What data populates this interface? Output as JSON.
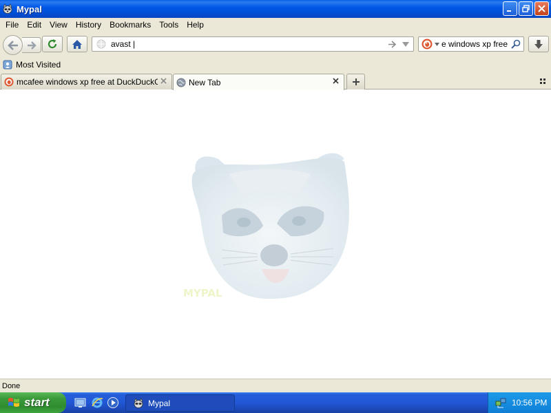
{
  "window": {
    "title": "Mypal"
  },
  "menu": {
    "items": [
      "File",
      "Edit",
      "View",
      "History",
      "Bookmarks",
      "Tools",
      "Help"
    ]
  },
  "navigation": {
    "url_value": "avast |",
    "search_value": "mcafee windows xp free"
  },
  "bookmarks": {
    "items": [
      {
        "label": "Most Visited"
      }
    ]
  },
  "tabs": [
    {
      "label": "mcafee windows xp free at DuckDuckGo",
      "active": false
    },
    {
      "label": "New Tab",
      "active": true
    }
  ],
  "status": {
    "text": "Done"
  },
  "taskbar": {
    "start_label": "start",
    "window_button": "Mypal",
    "clock": "10:56 PM"
  },
  "colors": {
    "titlebar": "#0058e6",
    "chrome": "#ebe8d8",
    "taskbar": "#2257d6",
    "start": "#3a9a3a"
  }
}
